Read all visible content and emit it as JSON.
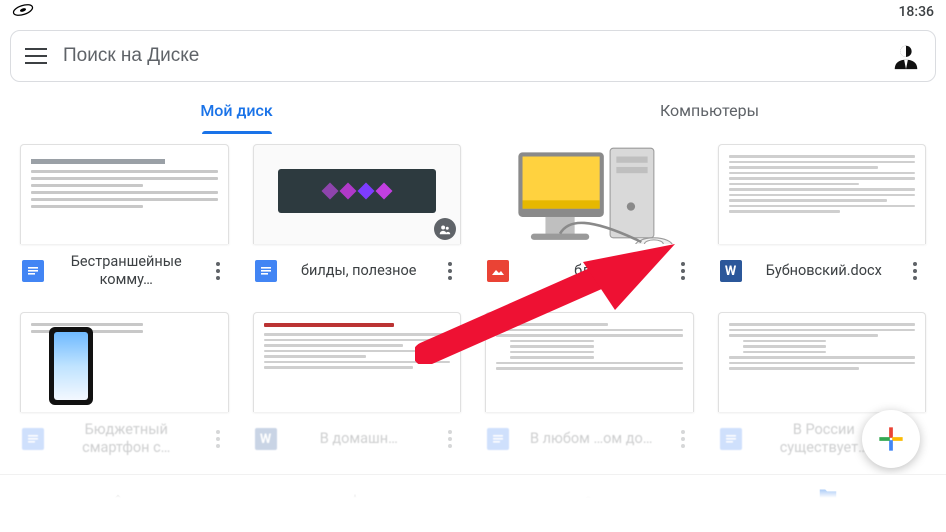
{
  "status": {
    "time": "18:36"
  },
  "search": {
    "placeholder": "Поиск на Диске"
  },
  "tabs": {
    "my_drive": "Мой диск",
    "computers": "Компьютеры"
  },
  "files": {
    "row1": [
      {
        "title": "Бестраншейные комму…",
        "type": "docs"
      },
      {
        "title": "билды, полезное",
        "type": "docs"
      },
      {
        "title": "бло…",
        "type": "img"
      },
      {
        "title": "Бубновский.docx",
        "type": "word"
      }
    ],
    "row2": [
      {
        "title": "Бюджетный смартфон с…",
        "type": "docs"
      },
      {
        "title": "В домашн…",
        "type": "word"
      },
      {
        "title": "В любом …ом до…",
        "type": "docs"
      },
      {
        "title": "В России существует…",
        "type": "docs"
      }
    ]
  },
  "nav": {
    "files": "Файлы"
  }
}
